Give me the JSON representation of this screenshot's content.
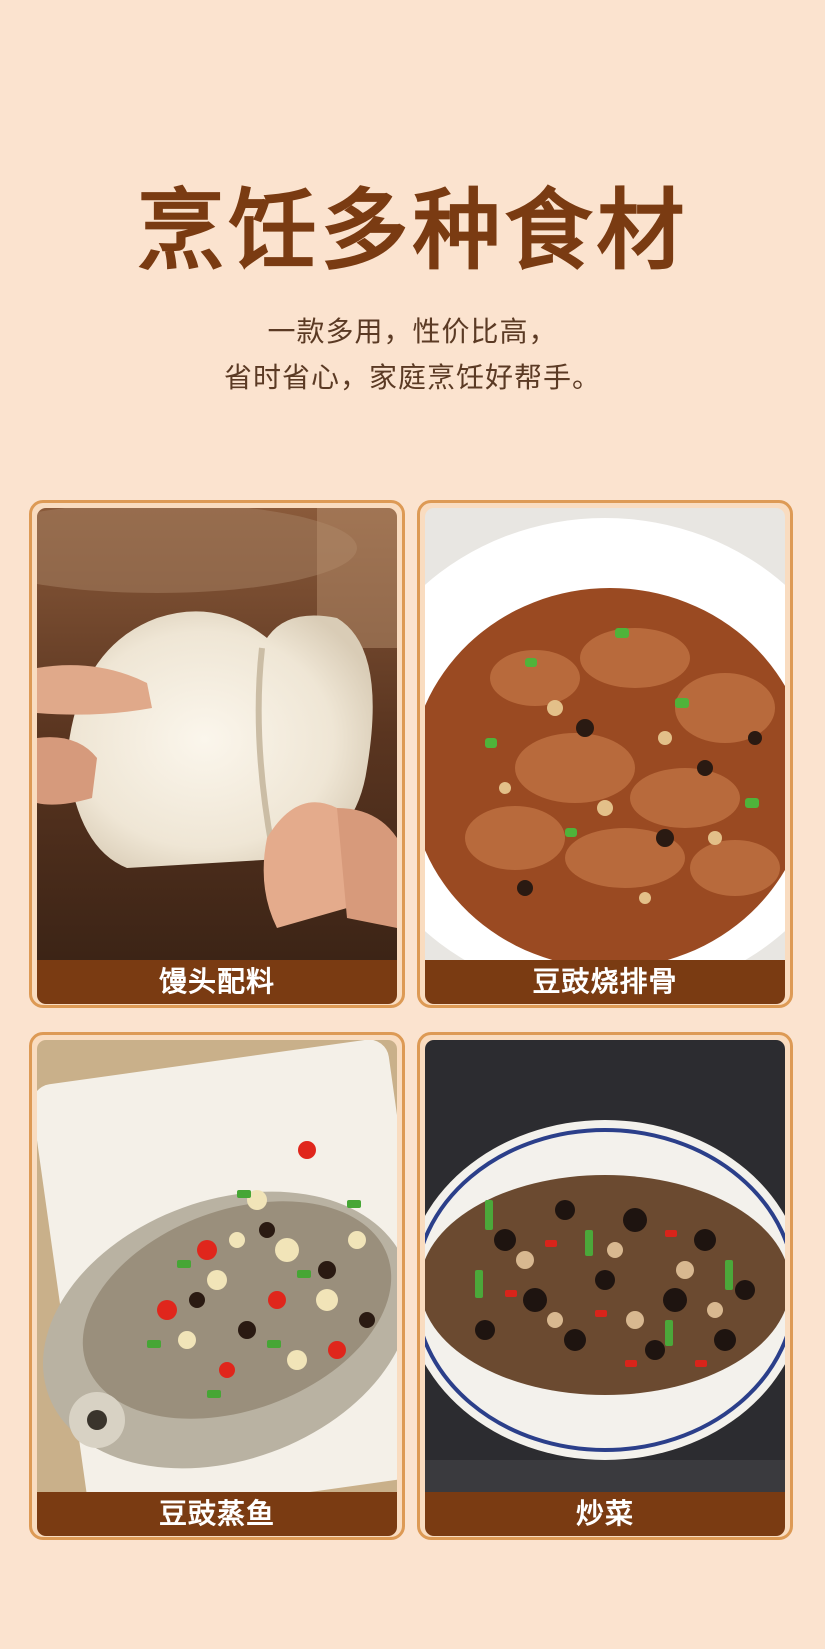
{
  "header": {
    "title": "烹饪多种食材",
    "subtitle_line1": "一款多用，性价比高，",
    "subtitle_line2": "省时省心，家庭烹饪好帮手。"
  },
  "cards": [
    {
      "label": "馒头配料",
      "image": "steamed-bun-photo"
    },
    {
      "label": "豆豉烧排骨",
      "image": "braised-ribs-photo"
    },
    {
      "label": "豆豉蒸鱼",
      "image": "steamed-fish-photo"
    },
    {
      "label": "炒菜",
      "image": "stir-fry-photo"
    }
  ],
  "colors": {
    "background": "#fbe3cf",
    "title": "#7a3b12",
    "label_bar": "#7a3b12",
    "card_border": "#dd9a55"
  }
}
